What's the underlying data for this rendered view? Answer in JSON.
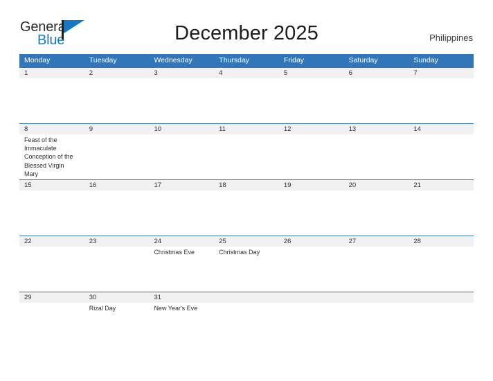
{
  "brand": {
    "name_part1": "General",
    "name_part2": "Blue",
    "flag_icon": "triangle-flag-icon",
    "colors": {
      "general_text": "#2b2b2b",
      "blue_text": "#1877c4",
      "flag": "#1877c4"
    }
  },
  "header": {
    "title": "December 2025",
    "region": "Philippines"
  },
  "calendar": {
    "colors": {
      "header_blue": "#3176b8",
      "date_band_gray": "#f1f1f1",
      "divider_blue": "#3176b8",
      "text": "#2e2e2e"
    },
    "weekdays": [
      "Monday",
      "Tuesday",
      "Wednesday",
      "Thursday",
      "Friday",
      "Saturday",
      "Sunday"
    ],
    "weeks": [
      {
        "days": [
          {
            "date": "1",
            "event": ""
          },
          {
            "date": "2",
            "event": ""
          },
          {
            "date": "3",
            "event": ""
          },
          {
            "date": "4",
            "event": ""
          },
          {
            "date": "5",
            "event": ""
          },
          {
            "date": "6",
            "event": ""
          },
          {
            "date": "7",
            "event": ""
          }
        ]
      },
      {
        "days": [
          {
            "date": "8",
            "event": "Feast of the Immaculate Conception of the Blessed Virgin Mary"
          },
          {
            "date": "9",
            "event": ""
          },
          {
            "date": "10",
            "event": ""
          },
          {
            "date": "11",
            "event": ""
          },
          {
            "date": "12",
            "event": ""
          },
          {
            "date": "13",
            "event": ""
          },
          {
            "date": "14",
            "event": ""
          }
        ]
      },
      {
        "days": [
          {
            "date": "15",
            "event": ""
          },
          {
            "date": "16",
            "event": ""
          },
          {
            "date": "17",
            "event": ""
          },
          {
            "date": "18",
            "event": ""
          },
          {
            "date": "19",
            "event": ""
          },
          {
            "date": "20",
            "event": ""
          },
          {
            "date": "21",
            "event": ""
          }
        ]
      },
      {
        "days": [
          {
            "date": "22",
            "event": ""
          },
          {
            "date": "23",
            "event": ""
          },
          {
            "date": "24",
            "event": "Christmas Eve"
          },
          {
            "date": "25",
            "event": "Christmas Day"
          },
          {
            "date": "26",
            "event": ""
          },
          {
            "date": "27",
            "event": ""
          },
          {
            "date": "28",
            "event": ""
          }
        ]
      },
      {
        "days": [
          {
            "date": "29",
            "event": ""
          },
          {
            "date": "30",
            "event": "Rizal Day"
          },
          {
            "date": "31",
            "event": "New Year's Eve"
          },
          {
            "date": "",
            "event": ""
          },
          {
            "date": "",
            "event": ""
          },
          {
            "date": "",
            "event": ""
          },
          {
            "date": "",
            "event": ""
          }
        ]
      }
    ]
  }
}
